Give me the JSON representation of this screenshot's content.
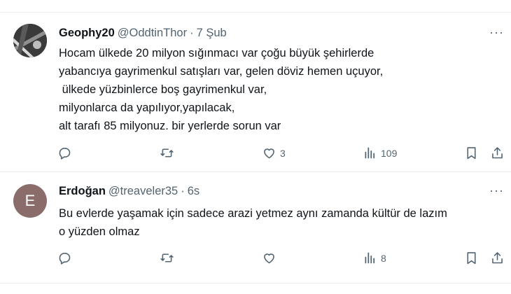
{
  "tweets": [
    {
      "name": "Geophy20",
      "handle": "@OddtinThor",
      "separator": "·",
      "time": "7 Şub",
      "more": "···",
      "lines": [
        "Hocam ülkede 20 milyon sığınmacı var çoğu büyük şehirlerde",
        "yabancıya gayrimenkul satışları var, gelen döviz hemen uçuyor,",
        " ülkede yüzbinlerce boş gayrimenkul var,",
        "milyonlarca da yapılıyor,yapılacak,",
        "alt tarafı 85 milyonuz. bir yerlerde sorun var"
      ],
      "likes": "3",
      "views": "109",
      "replies": "",
      "retweets": ""
    },
    {
      "name": "Erdoğan",
      "handle": "@treaveler35",
      "separator": "·",
      "time": "6s",
      "more": "···",
      "avatar_letter": "E",
      "lines": [
        "Bu evlerde yaşamak için sadece arazi yetmez aynı zamanda kültür de lazım",
        "o yüzden olmaz"
      ],
      "likes": "",
      "views": "8",
      "replies": "",
      "retweets": ""
    }
  ],
  "icons": [
    "reply-icon",
    "retweet-icon",
    "like-icon",
    "views-icon",
    "bookmark-icon",
    "share-icon"
  ],
  "colors": {
    "text": "#0f1419",
    "secondary": "#536471",
    "divider": "#e6ecf0",
    "avatar_e": "#8a6d6b"
  }
}
